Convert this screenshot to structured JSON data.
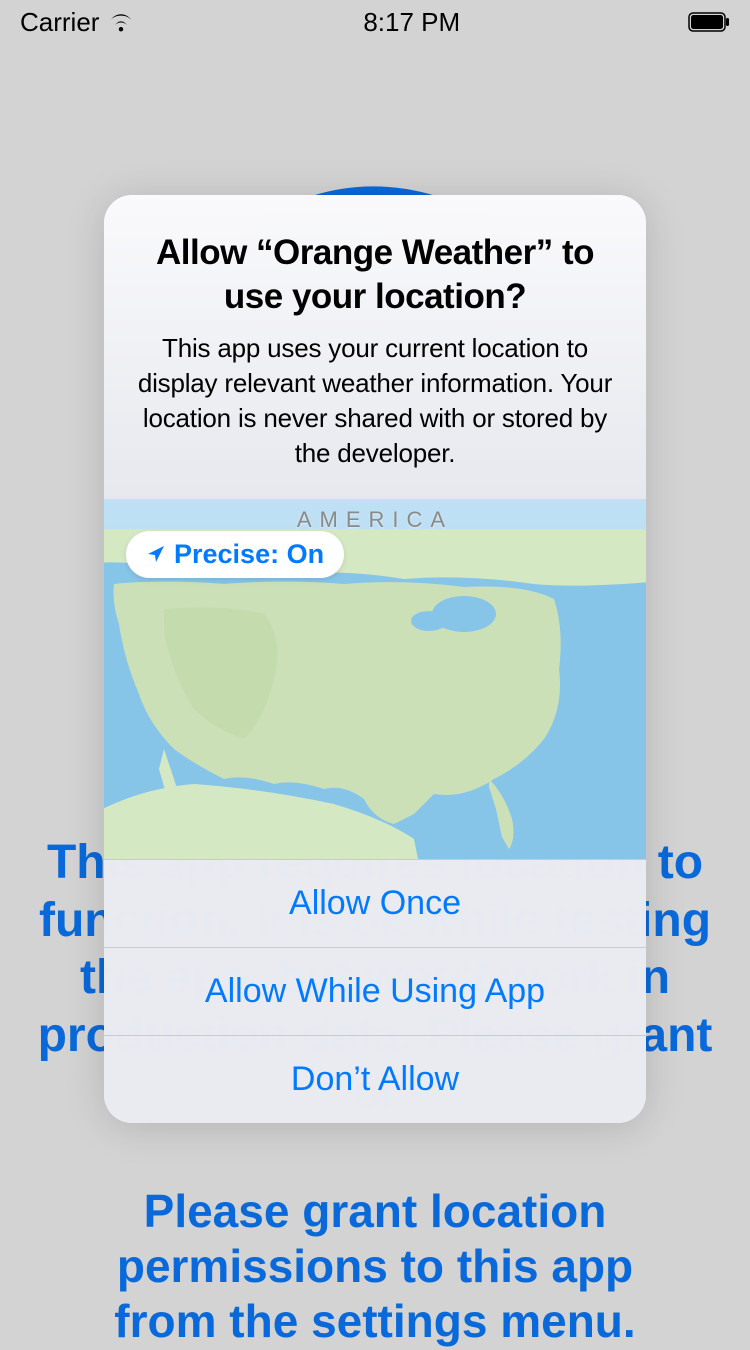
{
  "status_bar": {
    "carrier": "Carrier",
    "time": "8:17 PM"
  },
  "background": {
    "text_top": "This app requires location to function. It is ok while testing the app, but won't work in production data. Please grant or",
    "text_bottom": "Please grant location permissions to this app from the settings menu."
  },
  "alert": {
    "title": "Allow “Orange Weather” to use your location?",
    "message": "This app uses your current location to display relevant weather information. Your location is never shared with or stored by the developer.",
    "map_label": "AMERICA",
    "precise": "Precise: On",
    "buttons": {
      "allow_once": "Allow Once",
      "allow_while": "Allow While Using App",
      "dont_allow": "Don’t Allow"
    }
  }
}
